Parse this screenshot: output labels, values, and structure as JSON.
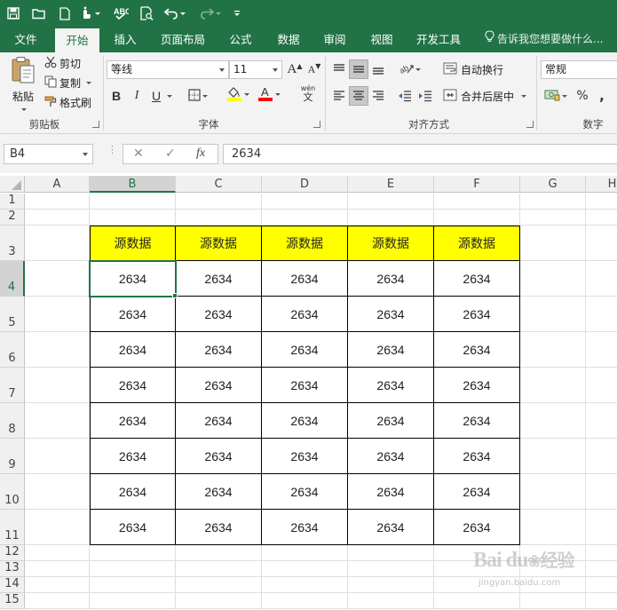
{
  "ribbon_tabs": [
    "文件",
    "开始",
    "插入",
    "页面布局",
    "公式",
    "数据",
    "审阅",
    "视图",
    "开发工具"
  ],
  "active_tab": "开始",
  "tell_me": "告诉我您想要做什么...",
  "clipboard": {
    "paste": "粘贴",
    "cut": "剪切",
    "copy": "复制",
    "format_painter": "格式刷",
    "group_label": "剪贴板"
  },
  "font": {
    "name": "等线",
    "size": "11",
    "bold": "B",
    "italic": "I",
    "underline": "U",
    "phonetic": "wén",
    "group_label": "字体"
  },
  "alignment": {
    "wrap_text": "自动换行",
    "merge_center": "合并后居中",
    "group_label": "对齐方式"
  },
  "number": {
    "format": "常规",
    "percent": "%",
    "comma": ",",
    "group_label": "数字"
  },
  "formula_bar": {
    "name_box": "B4",
    "cancel": "✕",
    "enter": "✓",
    "fx": "fx",
    "content": "2634"
  },
  "sheet": {
    "columns": [
      "A",
      "B",
      "C",
      "D",
      "E",
      "F",
      "G",
      "H"
    ],
    "rows": [
      "1",
      "2",
      "3",
      "4",
      "5",
      "6",
      "7",
      "8",
      "9",
      "10",
      "11",
      "12",
      "13",
      "14",
      "15"
    ],
    "selected_cell": "B4",
    "table_header": [
      "源数据",
      "源数据",
      "源数据",
      "源数据",
      "源数据"
    ],
    "table_rows": [
      [
        "2634",
        "2634",
        "2634",
        "2634",
        "2634"
      ],
      [
        "2634",
        "2634",
        "2634",
        "2634",
        "2634"
      ],
      [
        "2634",
        "2634",
        "2634",
        "2634",
        "2634"
      ],
      [
        "2634",
        "2634",
        "2634",
        "2634",
        "2634"
      ],
      [
        "2634",
        "2634",
        "2634",
        "2634",
        "2634"
      ],
      [
        "2634",
        "2634",
        "2634",
        "2634",
        "2634"
      ],
      [
        "2634",
        "2634",
        "2634",
        "2634",
        "2634"
      ],
      [
        "2634",
        "2634",
        "2634",
        "2634",
        "2634"
      ]
    ]
  },
  "watermark": {
    "brand": "Bai du",
    "brand_cn": "经验",
    "url": "jingyan.baidu.com"
  },
  "colors": {
    "excel_green": "#217346",
    "header_fill": "#ffff00",
    "font_color_bar": "#ff0000",
    "fill_color_bar": "#ffff00"
  }
}
